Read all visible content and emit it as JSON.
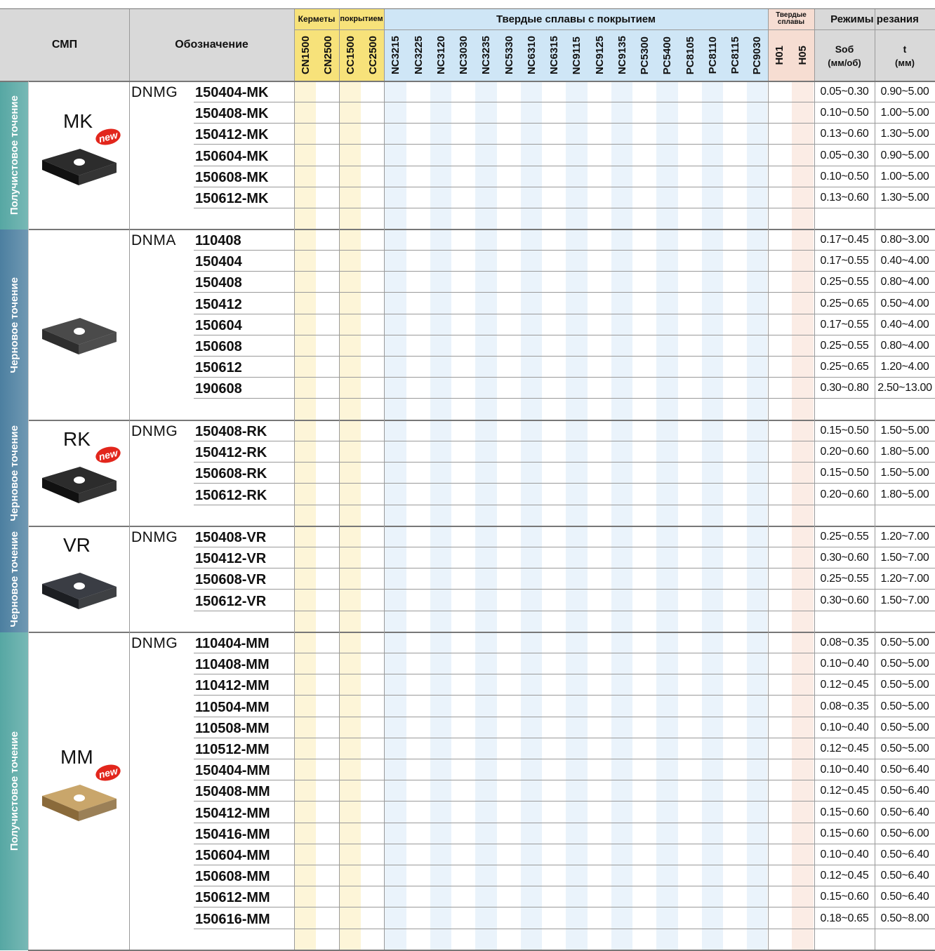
{
  "header": {
    "smp": "СМП",
    "designation": "Обозначение",
    "group_cermets": "Керметы",
    "group_coated": "покрытием",
    "group_coated_carbides": "Твердые сплавы с покрытием",
    "group_carbides": "Твердые сплавы",
    "group_modes": "Режимы резания",
    "feed_label": "Sоб",
    "feed_unit": "(мм/об)",
    "depth_label": "t",
    "depth_unit": "(мм)",
    "grades": [
      "CN1500",
      "CN2500",
      "CC1500",
      "CC2500",
      "NC3215",
      "NC3225",
      "NC3120",
      "NC3030",
      "NC3235",
      "NC5330",
      "NC6310",
      "NC6315",
      "NC9115",
      "NC9125",
      "NC9135",
      "PC5300",
      "PC5400",
      "PC8105",
      "PC8110",
      "PC8115",
      "PC9030",
      "H01",
      "H05"
    ]
  },
  "colors": {
    "header_bg": "#d9d9d9",
    "cermet_hdr": "#f7e27a",
    "coated_hdr": "#cfe6f6",
    "carbide_hdr": "#f6ddd2",
    "cermet_col": "#fdf5d8",
    "coated_col": "#eaf3fb",
    "carbide_col": "#fbece5",
    "new_badge": "#e2261c",
    "sect_teal": "#56a7a3",
    "sect_blue": "#4c7fa0"
  },
  "sections": [
    {
      "label": "Получистовое точение",
      "code": "MK",
      "new_badge": "new",
      "prefix": "DNMG",
      "icon": "insert-black-icon",
      "rows": [
        {
          "code": "150404-MK",
          "feed": "0.05~0.30",
          "depth": "0.90~5.00"
        },
        {
          "code": "150408-MK",
          "feed": "0.10~0.50",
          "depth": "1.00~5.00"
        },
        {
          "code": "150412-MK",
          "feed": "0.13~0.60",
          "depth": "1.30~5.00"
        },
        {
          "code": "150604-MK",
          "feed": "0.05~0.30",
          "depth": "0.90~5.00"
        },
        {
          "code": "150608-MK",
          "feed": "0.10~0.50",
          "depth": "1.00~5.00"
        },
        {
          "code": "150612-MK",
          "feed": "0.13~0.60",
          "depth": "1.30~5.00"
        }
      ]
    },
    {
      "label": "Черновое точение",
      "code": "",
      "new_badge": "",
      "prefix": "DNMA",
      "icon": "insert-gray-icon",
      "rows": [
        {
          "code": "110408",
          "feed": "0.17~0.45",
          "depth": "0.80~3.00"
        },
        {
          "code": "150404",
          "feed": "0.17~0.55",
          "depth": "0.40~4.00"
        },
        {
          "code": "150408",
          "feed": "0.25~0.55",
          "depth": "0.80~4.00"
        },
        {
          "code": "150412",
          "feed": "0.25~0.65",
          "depth": "0.50~4.00"
        },
        {
          "code": "150604",
          "feed": "0.17~0.55",
          "depth": "0.40~4.00"
        },
        {
          "code": "150608",
          "feed": "0.25~0.55",
          "depth": "0.80~4.00"
        },
        {
          "code": "150612",
          "feed": "0.25~0.65",
          "depth": "1.20~4.00"
        },
        {
          "code": "190608",
          "feed": "0.30~0.80",
          "depth": "2.50~13.00"
        }
      ]
    },
    {
      "label": "Черновое точение",
      "code": "RK",
      "new_badge": "new",
      "prefix": "DNMG",
      "icon": "insert-black-icon",
      "rows": [
        {
          "code": "150408-RK",
          "feed": "0.15~0.50",
          "depth": "1.50~5.00"
        },
        {
          "code": "150412-RK",
          "feed": "0.20~0.60",
          "depth": "1.80~5.00"
        },
        {
          "code": "150608-RK",
          "feed": "0.15~0.50",
          "depth": "1.50~5.00"
        },
        {
          "code": "150612-RK",
          "feed": "0.20~0.60",
          "depth": "1.80~5.00"
        }
      ]
    },
    {
      "label": "Черновое точение",
      "code": "VR",
      "new_badge": "",
      "prefix": "DNMG",
      "icon": "insert-dark-icon",
      "rows": [
        {
          "code": "150408-VR",
          "feed": "0.25~0.55",
          "depth": "1.20~7.00"
        },
        {
          "code": "150412-VR",
          "feed": "0.30~0.60",
          "depth": "1.50~7.00"
        },
        {
          "code": "150608-VR",
          "feed": "0.25~0.55",
          "depth": "1.20~7.00"
        },
        {
          "code": "150612-VR",
          "feed": "0.30~0.60",
          "depth": "1.50~7.00"
        }
      ]
    },
    {
      "label": "Получистовое точение",
      "code": "MM",
      "new_badge": "new",
      "prefix": "DNMG",
      "icon": "insert-gold-icon",
      "rows": [
        {
          "code": "110404-MM",
          "feed": "0.08~0.35",
          "depth": "0.50~5.00"
        },
        {
          "code": "110408-MM",
          "feed": "0.10~0.40",
          "depth": "0.50~5.00"
        },
        {
          "code": "110412-MM",
          "feed": "0.12~0.45",
          "depth": "0.50~5.00"
        },
        {
          "code": "110504-MM",
          "feed": "0.08~0.35",
          "depth": "0.50~5.00"
        },
        {
          "code": "110508-MM",
          "feed": "0.10~0.40",
          "depth": "0.50~5.00"
        },
        {
          "code": "110512-MM",
          "feed": "0.12~0.45",
          "depth": "0.50~5.00"
        },
        {
          "code": "150404-MM",
          "feed": "0.10~0.40",
          "depth": "0.50~6.40"
        },
        {
          "code": "150408-MM",
          "feed": "0.12~0.45",
          "depth": "0.50~6.40"
        },
        {
          "code": "150412-MM",
          "feed": "0.15~0.60",
          "depth": "0.50~6.40"
        },
        {
          "code": "150416-MM",
          "feed": "0.15~0.60",
          "depth": "0.50~6.00"
        },
        {
          "code": "150604-MM",
          "feed": "0.10~0.40",
          "depth": "0.50~6.40"
        },
        {
          "code": "150608-MM",
          "feed": "0.12~0.45",
          "depth": "0.50~6.40"
        },
        {
          "code": "150612-MM",
          "feed": "0.15~0.60",
          "depth": "0.50~6.40"
        },
        {
          "code": "150616-MM",
          "feed": "0.18~0.65",
          "depth": "0.50~8.00"
        }
      ]
    }
  ]
}
